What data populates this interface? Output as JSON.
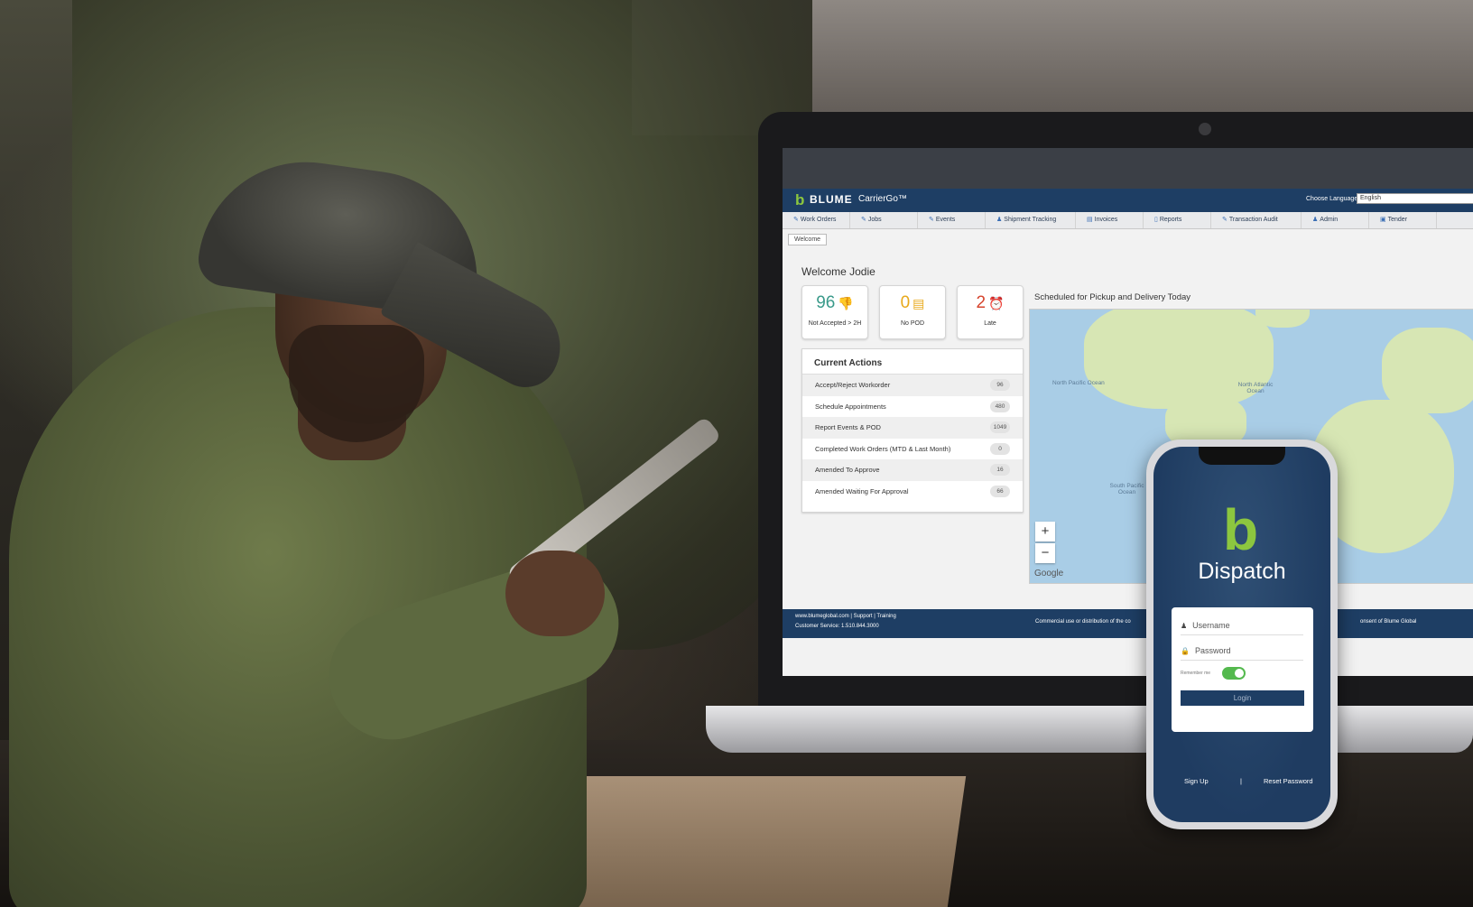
{
  "brand": {
    "logo_mark": "b",
    "logo_text": "BLUME",
    "product": "CarrierGo™"
  },
  "language": {
    "label": "Choose Language:",
    "value": "English"
  },
  "nav": [
    {
      "label": "Work Orders",
      "icon": "wrench-icon"
    },
    {
      "label": "Jobs",
      "icon": "wrench-icon"
    },
    {
      "label": "Events",
      "icon": "wrench-icon"
    },
    {
      "label": "Shipment Tracking",
      "icon": "person-icon"
    },
    {
      "label": "Invoices",
      "icon": "invoice-icon"
    },
    {
      "label": "Reports",
      "icon": "report-icon"
    },
    {
      "label": "Transaction Audit",
      "icon": "wrench-icon"
    },
    {
      "label": "Admin",
      "icon": "person-icon"
    },
    {
      "label": "Tender",
      "icon": "tender-icon"
    }
  ],
  "tab": "Welcome",
  "welcome": "Welcome Jodie",
  "stats": [
    {
      "value": "96",
      "label": "Not Accepted > 2H",
      "icon": "thumbs-down-icon",
      "color": "#3a9a8a"
    },
    {
      "value": "0",
      "label": "No POD",
      "icon": "clipboard-icon",
      "color": "#e8a91b"
    },
    {
      "value": "2",
      "label": "Late",
      "icon": "alarm-clock-icon",
      "color": "#d6452e"
    }
  ],
  "current_actions": {
    "title": "Current Actions",
    "rows": [
      {
        "label": "Accept/Reject Workorder",
        "count": "96"
      },
      {
        "label": "Schedule Appointments",
        "count": "480"
      },
      {
        "label": "Report Events & POD",
        "count": "1049"
      },
      {
        "label": "Completed Work Orders (MTD & Last Month)",
        "count": "0"
      },
      {
        "label": "Amended To Approve",
        "count": "16"
      },
      {
        "label": "Amended Waiting For Approval",
        "count": "66"
      }
    ]
  },
  "map": {
    "title": "Scheduled for Pickup and Delivery Today",
    "zoom_in": "+",
    "zoom_out": "−",
    "attribution": "Google",
    "oceans": [
      "North Pacific Ocean",
      "North Atlantic Ocean",
      "South Pacific Ocean"
    ]
  },
  "footer": {
    "links": "www.blumeglobal.com | Support | Training",
    "service": "Customer Service: 1.510.844.3000",
    "legal_left": "Commercial use or distribution of the co",
    "legal_right": "onsent of Blume Global"
  },
  "phone": {
    "logo_mark": "b",
    "title": "Dispatch",
    "username_placeholder": "Username",
    "password_placeholder": "Password",
    "remember_label": "Remember me",
    "remember_on": true,
    "login_label": "Login",
    "signup": "Sign Up",
    "separator": "|",
    "reset": "Reset Password"
  },
  "colors": {
    "brand_green": "#8cc63f",
    "header_navy": "#1e3e64",
    "toggle_on": "#54b94e"
  }
}
